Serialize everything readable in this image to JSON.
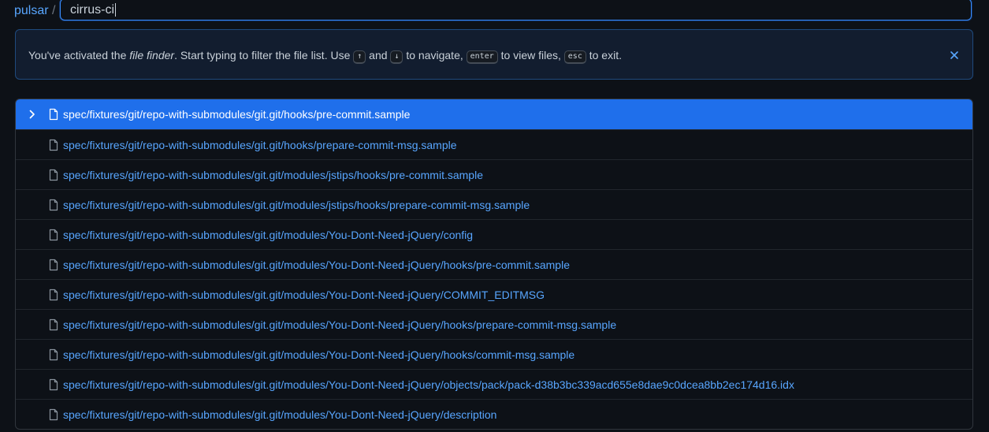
{
  "header": {
    "repo_name": "pulsar",
    "separator": "/",
    "search_value": "cirrus-ci"
  },
  "flash": {
    "text_before": "You've activated the ",
    "text_emphasis": "file finder",
    "text_after_emphasis": ". Start typing to filter the file list. Use ",
    "key_up": "↑",
    "text_and": " and ",
    "key_down": "↓",
    "text_to_navigate": " to navigate, ",
    "key_enter": "enter",
    "text_to_view": " to view files, ",
    "key_esc": "esc",
    "text_to_exit": " to exit."
  },
  "files": [
    {
      "path": "spec/fixtures/git/repo-with-submodules/git.git/hooks/pre-commit.sample",
      "selected": true
    },
    {
      "path": "spec/fixtures/git/repo-with-submodules/git.git/hooks/prepare-commit-msg.sample",
      "selected": false
    },
    {
      "path": "spec/fixtures/git/repo-with-submodules/git.git/modules/jstips/hooks/pre-commit.sample",
      "selected": false
    },
    {
      "path": "spec/fixtures/git/repo-with-submodules/git.git/modules/jstips/hooks/prepare-commit-msg.sample",
      "selected": false
    },
    {
      "path": "spec/fixtures/git/repo-with-submodules/git.git/modules/You-Dont-Need-jQuery/config",
      "selected": false
    },
    {
      "path": "spec/fixtures/git/repo-with-submodules/git.git/modules/You-Dont-Need-jQuery/hooks/pre-commit.sample",
      "selected": false
    },
    {
      "path": "spec/fixtures/git/repo-with-submodules/git.git/modules/You-Dont-Need-jQuery/COMMIT_EDITMSG",
      "selected": false
    },
    {
      "path": "spec/fixtures/git/repo-with-submodules/git.git/modules/You-Dont-Need-jQuery/hooks/prepare-commit-msg.sample",
      "selected": false
    },
    {
      "path": "spec/fixtures/git/repo-with-submodules/git.git/modules/You-Dont-Need-jQuery/hooks/commit-msg.sample",
      "selected": false
    },
    {
      "path": "spec/fixtures/git/repo-with-submodules/git.git/modules/You-Dont-Need-jQuery/objects/pack/pack-d38b3bc339acd655e8dae9c0dcea8bb2ec174d16.idx",
      "selected": false
    },
    {
      "path": "spec/fixtures/git/repo-with-submodules/git.git/modules/You-Dont-Need-jQuery/description",
      "selected": false
    }
  ],
  "icons": {
    "row_expand": "chevron-right-icon",
    "row_file": "file-icon",
    "flash_close": "close-icon"
  },
  "colors": {
    "background": "#0d1117",
    "link": "#58a6ff",
    "selected_row": "#1f6feb",
    "flash_bg": "#121d2f",
    "flash_border": "#1f4a7d"
  }
}
